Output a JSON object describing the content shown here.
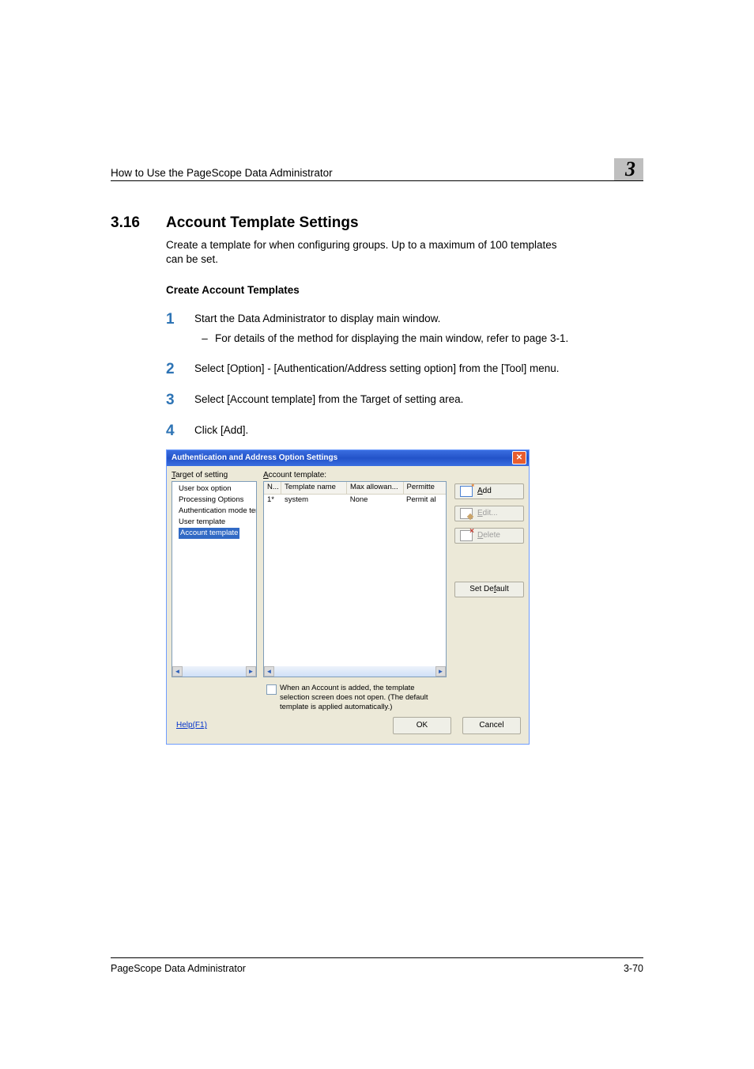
{
  "header": {
    "running_title": "How to Use the PageScope Data Administrator",
    "chapter_number": "3"
  },
  "section": {
    "number": "3.16",
    "title": "Account Template Settings",
    "intro": "Create a template for when configuring groups. Up to a maximum of 100 templates can be set.",
    "subheading": "Create Account Templates"
  },
  "steps": [
    {
      "n": "1",
      "text": "Start the Data Administrator to display main window.",
      "sub": [
        "For details of the method for displaying the main window, refer to page 3-1."
      ]
    },
    {
      "n": "2",
      "text": "Select [Option] - [Authentication/Address setting option] from the [Tool] menu."
    },
    {
      "n": "3",
      "text": "Select [Account template] from the Target of setting area."
    },
    {
      "n": "4",
      "text": "Click [Add]."
    }
  ],
  "dialog": {
    "title": "Authentication and Address Option Settings",
    "close_glyph": "✕",
    "tree": {
      "label_prefix": "T",
      "label_suffix": "arget of setting",
      "items": [
        "User box option",
        "Processing Options",
        "Authentication mode tem",
        "User template"
      ],
      "selected": "Account template"
    },
    "table": {
      "label_prefix": "A",
      "label_suffix": "ccount template:",
      "columns": [
        "N...",
        "Template name",
        "Max allowan...",
        "Permitte"
      ],
      "rows": [
        {
          "n": "1*",
          "name": "system",
          "max": "None",
          "perm": "Permit al"
        }
      ]
    },
    "actions": {
      "add": "Add",
      "add_ul": "A",
      "edit": "Edit...",
      "edit_ul": "E",
      "delete": "Delete",
      "delete_ul": "D",
      "set_default": "Set Default",
      "set_default_ul": "f"
    },
    "checkbox_text": "When an Account is added, the template selection screen does not open. (The default template is applied automatically.)",
    "help": "Help(F1)",
    "ok": "OK",
    "cancel": "Cancel"
  },
  "footer": {
    "product": "PageScope Data Administrator",
    "page": "3-70"
  }
}
